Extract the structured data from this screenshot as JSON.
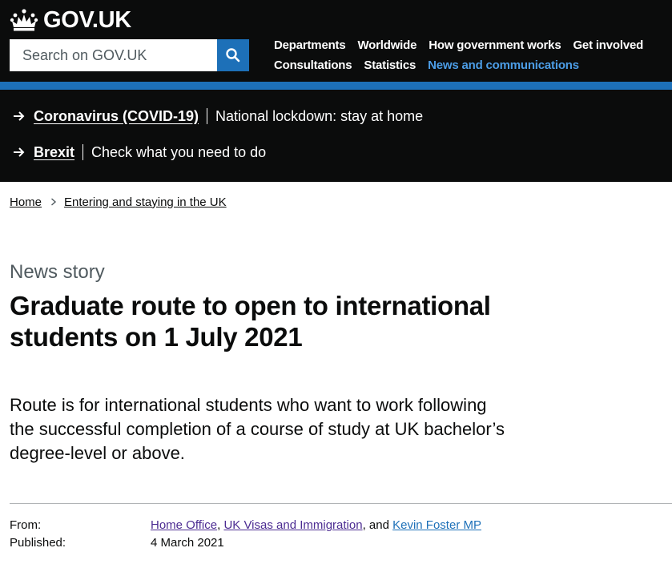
{
  "header": {
    "logo_text": "GOV.UK",
    "search": {
      "placeholder": "Search on GOV.UK"
    },
    "nav": {
      "row1": [
        {
          "label": "Departments"
        },
        {
          "label": "Worldwide"
        },
        {
          "label": "How government works"
        },
        {
          "label": "Get involved"
        }
      ],
      "row2": [
        {
          "label": "Consultations"
        },
        {
          "label": "Statistics"
        },
        {
          "label": "News and communications",
          "active": true
        }
      ]
    }
  },
  "banner": {
    "items": [
      {
        "link": "Coronavirus (COVID-19)",
        "text": "National lockdown: stay at home"
      },
      {
        "link": "Brexit",
        "text": "Check what you need to do"
      }
    ]
  },
  "breadcrumb": [
    {
      "label": "Home"
    },
    {
      "label": "Entering and staying in the UK"
    }
  ],
  "article": {
    "caption": "News story",
    "title": "Graduate route to open to international students on 1 July 2021",
    "lead": "Route is for international students who want to work following the successful completion of a course of study at UK bachelor’s degree-level or above."
  },
  "metadata": {
    "from_label": "From:",
    "from": [
      {
        "label": "Home Office"
      },
      {
        "label": "UK Visas and Immigration"
      },
      {
        "label": "Kevin Foster MP"
      }
    ],
    "from_sep1": ", ",
    "from_sep2": ", and ",
    "published_label": "Published:",
    "published": "4 March 2021"
  },
  "colors": {
    "header_bg": "#0b0c0c",
    "brand_blue": "#1d70b8",
    "link_visited": "#4c2c92",
    "text": "#0b0c0c",
    "secondary_text": "#505a5f"
  },
  "icons": {
    "logo": "crown-icon",
    "search": "search-icon",
    "banner": "arrow-right-icon",
    "breadcrumb": "chevron-right-icon"
  }
}
